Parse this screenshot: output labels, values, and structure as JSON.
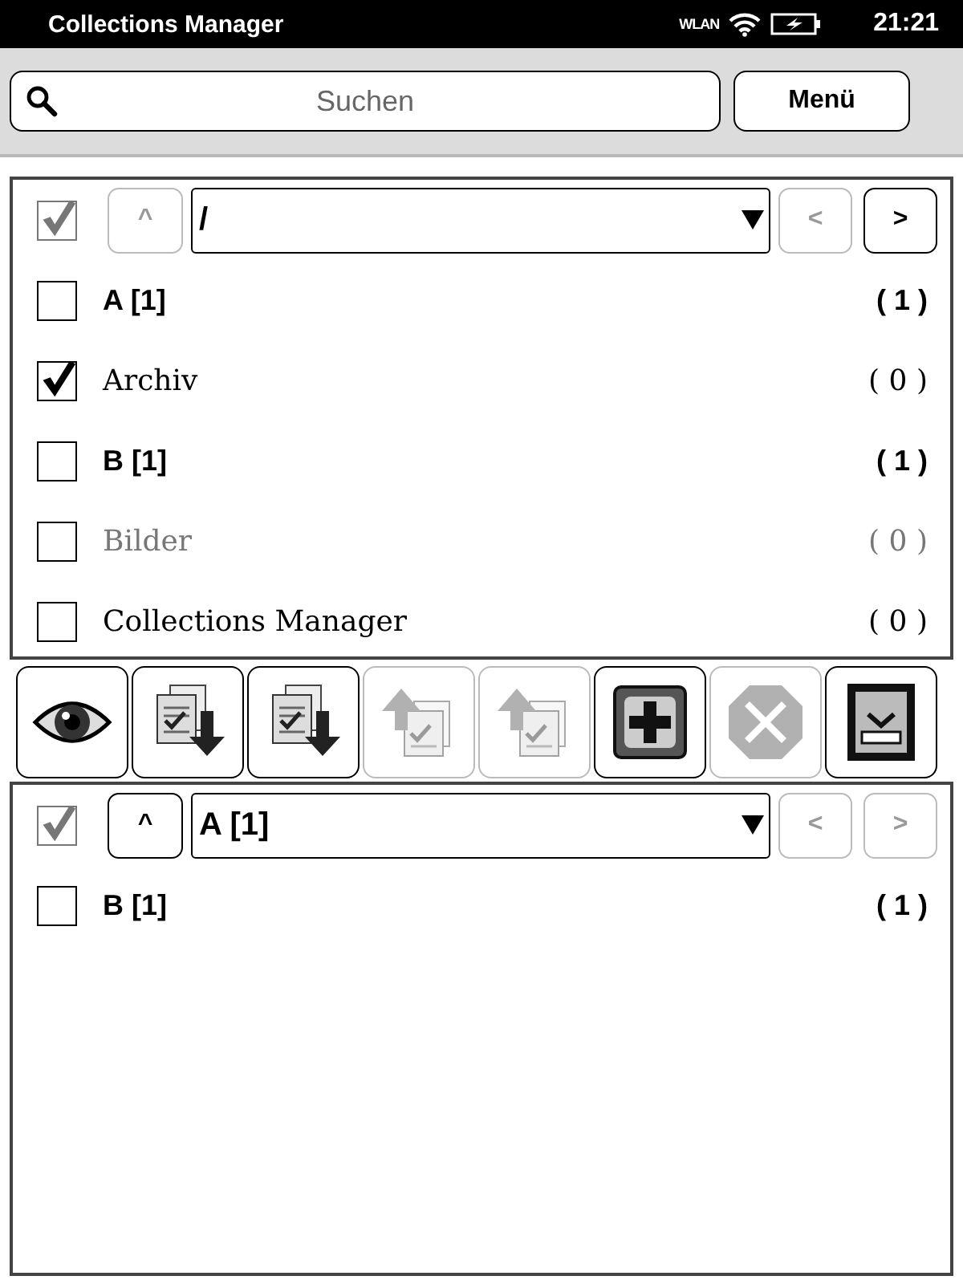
{
  "status_bar": {
    "title": "Collections Manager",
    "wlan": "WLAN",
    "time": "21:21"
  },
  "search": {
    "placeholder": "Suchen"
  },
  "menu_button": "Menü",
  "panels": [
    {
      "select_all_checked": true,
      "up_button": {
        "label": "^",
        "disabled": true
      },
      "path": "/",
      "prev_button": {
        "label": "<",
        "disabled": true
      },
      "next_button": {
        "label": ">",
        "disabled": false
      },
      "items": [
        {
          "kind": "folder",
          "name": "A [1]",
          "count": "( 1 )",
          "checked": false,
          "disabled": false
        },
        {
          "kind": "collection",
          "name": "Archiv",
          "count": "( 0 )",
          "checked": true,
          "disabled": false
        },
        {
          "kind": "folder",
          "name": "B [1]",
          "count": "( 1 )",
          "checked": false,
          "disabled": false
        },
        {
          "kind": "collection",
          "name": "Bilder",
          "count": "( 0 )",
          "checked": false,
          "disabled": true
        },
        {
          "kind": "collection",
          "name": "Collections Manager",
          "count": "( 0 )",
          "checked": false,
          "disabled": false
        }
      ]
    },
    {
      "select_all_checked": true,
      "up_button": {
        "label": "^",
        "disabled": false
      },
      "path": "A [1]",
      "prev_button": {
        "label": "<",
        "disabled": true
      },
      "next_button": {
        "label": ">",
        "disabled": true
      },
      "items": [
        {
          "kind": "folder",
          "name": "B [1]",
          "count": "( 1 )",
          "checked": false,
          "disabled": false
        }
      ]
    }
  ],
  "toolbar": [
    {
      "kind": "view",
      "disabled": false
    },
    {
      "kind": "import",
      "disabled": false
    },
    {
      "kind": "import",
      "disabled": false
    },
    {
      "kind": "export",
      "disabled": true
    },
    {
      "kind": "export",
      "disabled": true
    },
    {
      "kind": "add",
      "disabled": false
    },
    {
      "kind": "delete",
      "disabled": true
    },
    {
      "kind": "save",
      "disabled": false
    }
  ]
}
